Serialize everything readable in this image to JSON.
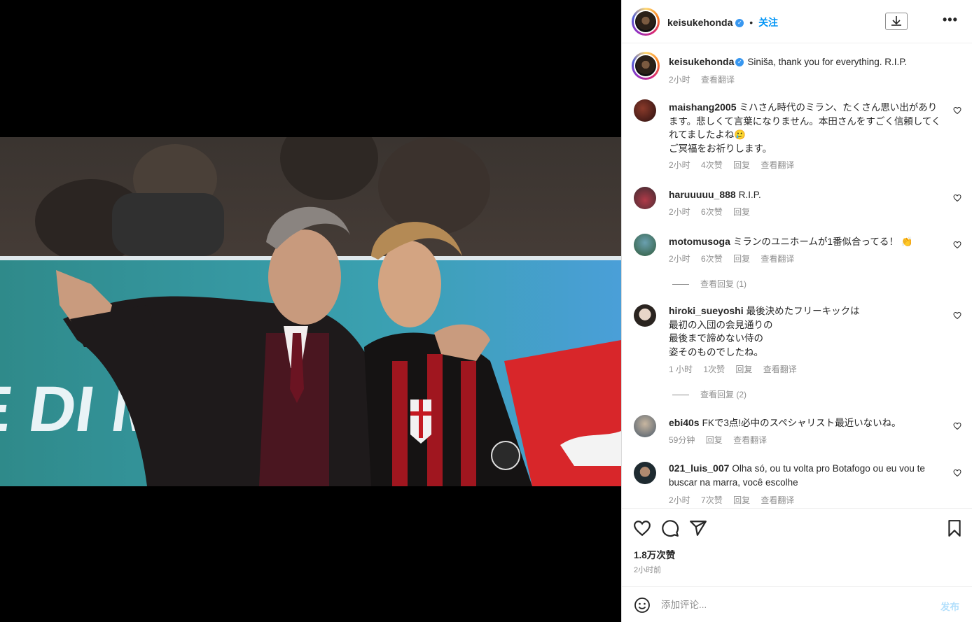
{
  "post": {
    "username": "keisukehonda",
    "follow_label": "关注",
    "caption": "Siniša, thank you for everything. R.I.P.",
    "caption_time": "2小时",
    "caption_translate": "查看翻译"
  },
  "comments": [
    {
      "user": "maishang2005",
      "text": "ミハさん時代のミラン、たくさん思い出があります。悲しくて言葉になりません。本田さんをすごく信頼してくれてましたよね🥲\nご冥福をお祈りします。",
      "time": "2小时",
      "likes": "4次赞",
      "reply": "回复",
      "translate": "查看翻译"
    },
    {
      "user": "haruuuuu_888",
      "text": "R.I.P.",
      "time": "2小时",
      "likes": "6次赞",
      "reply": "回复",
      "translate": ""
    },
    {
      "user": "motomusoga",
      "text": "ミランのユニホームが1番似合ってる！ 👏",
      "time": "2小时",
      "likes": "6次赞",
      "reply": "回复",
      "translate": "查看翻译",
      "view_replies": "查看回复 (1)"
    },
    {
      "user": "hiroki_sueyoshi",
      "text": "最後決めたフリーキックは\n最初の入団の会見通りの\n最後まで諦めない侍の\n姿そのものでしたね。",
      "time": "1 小时",
      "likes": "1次赞",
      "reply": "回复",
      "translate": "查看翻译",
      "view_replies": "查看回复 (2)"
    },
    {
      "user": "ebi40s",
      "text": "FKで3点!必中のスペシャリスト最近いないね。",
      "time": "59分钟",
      "likes": "",
      "reply": "回复",
      "translate": "查看翻译"
    },
    {
      "user": "021_luis_007",
      "text": "Olha só, ou tu volta pro Botafogo ou eu vou te buscar na marra, você escolhe",
      "time": "2小时",
      "likes": "7次赞",
      "reply": "回复",
      "translate": "查看翻译"
    }
  ],
  "actions": {
    "like_count": "1.8万次赞",
    "posted_ago": "2小时前"
  },
  "composer": {
    "placeholder": "添加评论...",
    "post_label": "发布"
  },
  "icons": [
    "heart-icon",
    "comment-icon",
    "share-icon",
    "bookmark-icon",
    "download-icon",
    "more-icon",
    "emoji-icon",
    "verified-icon"
  ],
  "colors": {
    "accent": "#0095f6",
    "verified": "#3897f0",
    "post_disabled": "#b2dffc"
  }
}
